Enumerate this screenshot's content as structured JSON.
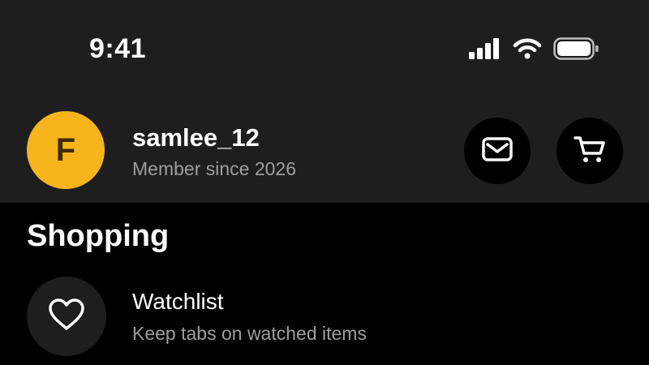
{
  "status_bar": {
    "time": "9:41",
    "icons": [
      "cellular-signal-icon",
      "wifi-icon",
      "battery-icon"
    ]
  },
  "profile": {
    "avatar_initial": "F",
    "avatar_color": "#f7b41c",
    "username": "samlee_12",
    "member_since": "Member since 2026",
    "actions": [
      {
        "icon": "mail-icon"
      },
      {
        "icon": "cart-icon"
      }
    ]
  },
  "shopping": {
    "title": "Shopping",
    "items": [
      {
        "icon": "heart-icon",
        "label": "Watchlist",
        "description": "Keep tabs on watched items"
      }
    ]
  },
  "colors": {
    "header_background": "#1e1e1e",
    "page_background": "#000000",
    "secondary_text": "#9e9e9e"
  }
}
